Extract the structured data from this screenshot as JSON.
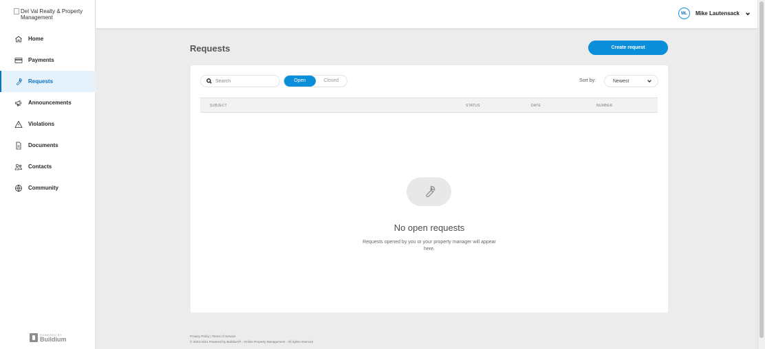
{
  "brand": {
    "logo_alt": "Del Val Realty & Property Management",
    "accent": "#0b8fdb"
  },
  "sidebar": {
    "items": [
      {
        "label": "Home",
        "icon": "home-icon"
      },
      {
        "label": "Payments",
        "icon": "credit-card-icon"
      },
      {
        "label": "Requests",
        "icon": "wrench-icon",
        "active": true
      },
      {
        "label": "Announcements",
        "icon": "megaphone-icon"
      },
      {
        "label": "Violations",
        "icon": "warning-icon"
      },
      {
        "label": "Documents",
        "icon": "document-icon"
      },
      {
        "label": "Contacts",
        "icon": "contacts-icon"
      },
      {
        "label": "Community",
        "icon": "globe-icon"
      }
    ],
    "powered_by": "POWERED BY",
    "powered_brand": "Buildium"
  },
  "header": {
    "user_initials": "ML",
    "user_name": "Mike Lautensack"
  },
  "main": {
    "title": "Requests",
    "create_label": "Create request",
    "search_placeholder": "Search",
    "filters": [
      "Open",
      "Closed"
    ],
    "active_filter": "Open",
    "sort_label": "Sort by:",
    "sort_value": "Newest",
    "columns": [
      "SUBJECT",
      "STATUS",
      "DATE",
      "NUMBER"
    ],
    "empty_title": "No open requests",
    "empty_desc": "Requests opened by you or your property manager will appear here."
  },
  "footer": {
    "privacy": "Privacy Policy",
    "separator": " | ",
    "terms": "Terms of Service",
    "copyright": "© 2003-2021 Powered by Buildium® - Online Property Management - All rights reserved"
  }
}
